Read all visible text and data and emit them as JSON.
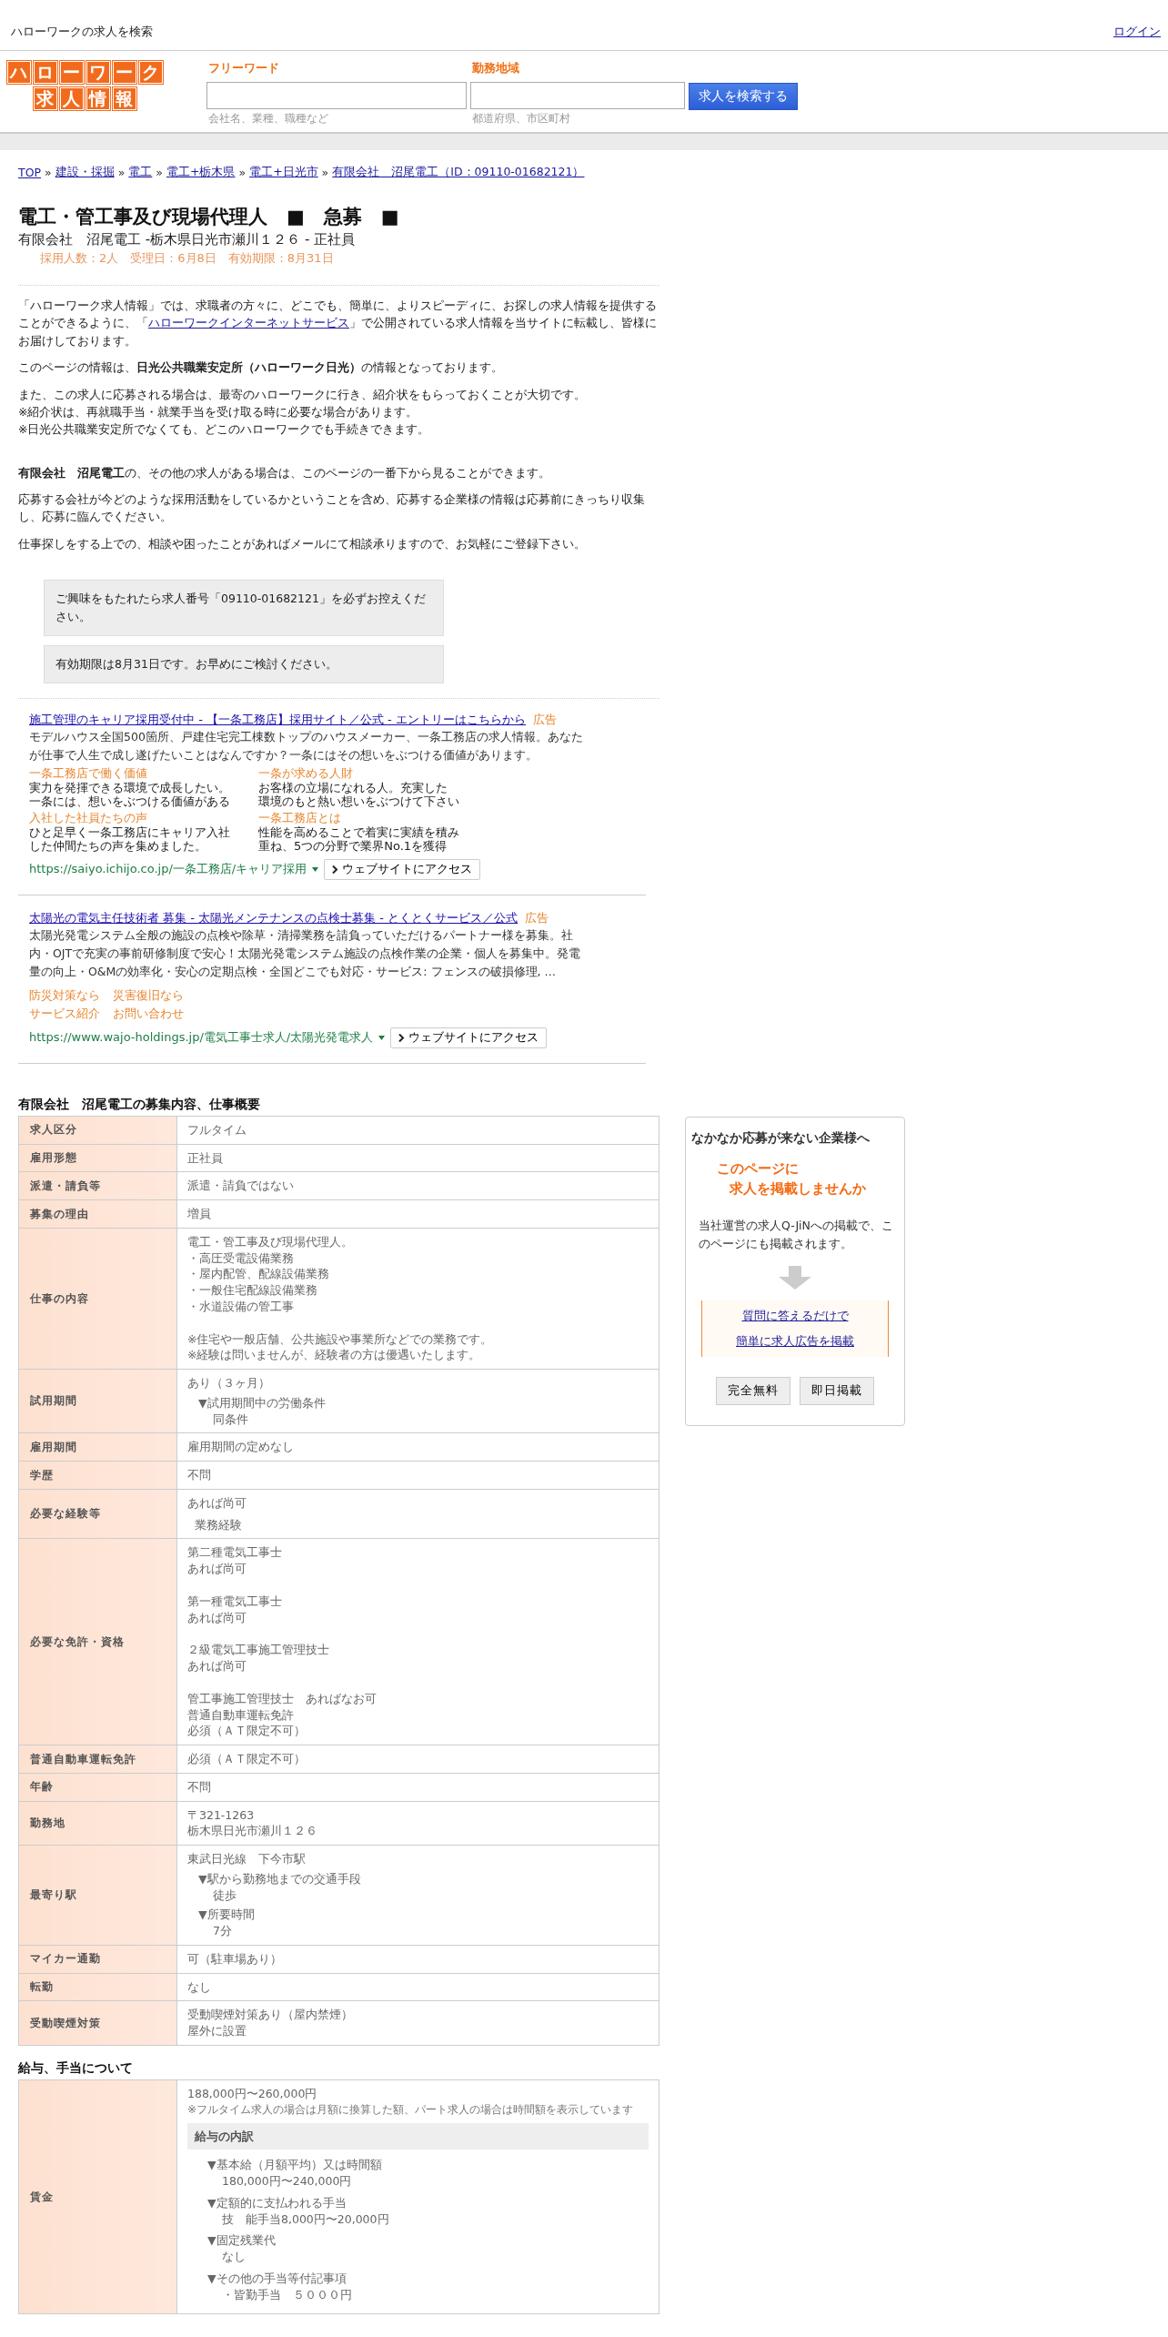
{
  "top_bar": {
    "title": "ハローワークの求人を検索",
    "login": "ログイン"
  },
  "logo": {
    "row_1": [
      "ハ",
      "ロ",
      "ー",
      "ワ",
      "ー",
      "ク"
    ],
    "row_2": [
      "求",
      "人",
      "情",
      "報"
    ]
  },
  "search": {
    "fields": [
      {
        "label": "フリーワード",
        "hint": "会社名、業種、職種など"
      },
      {
        "label": "勤務地域",
        "hint": "都道府県、市区町村"
      }
    ],
    "button": "求人を検索する"
  },
  "breadcrumb": [
    {
      "text": "TOP"
    },
    {
      "separator": "»",
      "text": "建設・採掘"
    },
    {
      "separator": "»",
      "text": "電工"
    },
    {
      "separator": "»",
      "text": "電工+栃木県"
    },
    {
      "separator": "»",
      "text": "電工+日光市"
    },
    {
      "separator": "»",
      "text": "有限会社　沼尾電工（ID：09110-01682121）"
    }
  ],
  "job": {
    "title": "電工・管工事及び現場代理人　■　急募　■",
    "subtitle": "有限会社　沼尾電工 -栃木県日光市瀬川１２６ - 正社員",
    "meta": "採用人数：2人　受理日：6月8日　有効期限：8月31日"
  },
  "intro": [
    [
      {
        "kind": "text",
        "text": "「ハローワーク求人情報」では、求職者の方々に、どこでも、簡単に、よりスピーディに、お探しの求人情報を提供することができるように、「"
      },
      {
        "kind": "link",
        "text": "ハローワークインターネットサービス"
      },
      {
        "kind": "text",
        "text": "」で公開されている求人情報を当サイトに転載し、皆様にお届けしております。"
      }
    ],
    [
      {
        "kind": "text",
        "text": "このページの情報は、**日光公共職業安定所（ハローワーク日光）**の情報となっております。"
      }
    ],
    [
      {
        "kind": "text",
        "text": "また、この求人に応募される場合は、最寄のハローワークに行き、紹介状をもらっておくことが大切です。"
      },
      {
        "kind": "break"
      },
      {
        "kind": "text",
        "text": "※紹介状は、再就職手当・就業手当を受け取る時に必要な場合があります。"
      },
      {
        "kind": "break"
      },
      {
        "kind": "text",
        "text": "※日光公共職業安定所でなくても、どこのハローワークでも手続きできます。"
      }
    ]
  ],
  "company_notes": [
    "**有限会社　沼尾電工**の、その他の求人がある場合は、このページの一番下から見ることができます。",
    "応募する会社が今どのような採用活動をしているかということを含め、応募する企業様の情報は応募前にきっちり収集し、応募に臨んでください。",
    "仕事探しをする上での、相談や困ったことがあればメールにて相談承りますので、お気軽にご登録下さい。"
  ],
  "notices": [
    "ご興味をもたれたら求人番号「09110-01682121」を必ずお控えください。",
    "有効期限は8月31日です。お早めにご検討ください。"
  ],
  "ads": [
    {
      "title": "施工管理のキャリア採用受付中 - 【一条工務店】採用サイト／公式 - エントリーはこちらから",
      "badge": "広告",
      "description": "モデルハウス全国500箇所、戸建住宅完工棟数トップのハウスメーカー、一条工務店の求人情報。あなたが仕事で人生で成し遂げたいことはなんですか？一条にはその想いをぶつける価値があります。",
      "kind": "sitelinks",
      "sitelinks": [
        {
          "title": "一条工務店で働く価値",
          "lines": [
            "実力を発揮できる環境で成長したい。",
            "一条には、想いをぶつける価値がある"
          ]
        },
        {
          "title": "一条が求める人財",
          "lines": [
            "お客様の立場になれる人。充実した",
            "環境のもと熱い想いをぶつけて下さい"
          ]
        },
        {
          "title": "入社した社員たちの声",
          "lines": [
            "ひと足早く一条工務店にキャリア入社",
            "した仲間たちの声を集めました。"
          ]
        },
        {
          "title": "一条工務店とは",
          "lines": [
            "性能を高めることで着実に実績を積み",
            "重ね、5つの分野で業界No.1を獲得"
          ]
        }
      ],
      "url": "https://saiyo.ichijo.co.jp/一条工務店/キャリア採用",
      "button": "ウェブサイトにアクセス"
    },
    {
      "title": "太陽光の電気主任技術者 募集 - 太陽光メンテナンスの点検士募集 - とくとくサービス／公式",
      "badge": "広告",
      "description": "太陽光発電システム全般の施設の点検や除草・清掃業務を請負っていただけるパートナー様を募集。社内・OJTで充実の事前研修制度で安心！太陽光発電システム施設の点検作業の企業・個人を募集中。発電量の向上・O&Mの効率化・安心の定期点検・全国どこでも対応・サービス: フェンスの破損修理, …",
      "kind": "quicklinks",
      "quicklinks": [
        [
          "防災対策なら",
          "災害復旧なら"
        ],
        [
          "サービス紹介",
          "お問い合わせ"
        ]
      ],
      "url": "https://www.wajo-holdings.jp/電気工事士求人/太陽光発電求人",
      "button": "ウェブサイトにアクセス"
    }
  ],
  "overview": {
    "title": "有限会社　沼尾電工の募集内容、仕事概要",
    "rows": [
      {
        "label": "求人区分",
        "kind": "plain",
        "blocks": [
          {
            "kind": "text",
            "lines": [
              "フルタイム"
            ]
          }
        ]
      },
      {
        "label": "雇用形態",
        "kind": "plain",
        "blocks": [
          {
            "kind": "text",
            "lines": [
              "正社員"
            ]
          }
        ]
      },
      {
        "label": "派遣・請負等",
        "kind": "plain",
        "blocks": [
          {
            "kind": "text",
            "lines": [
              "派遣・請負ではない"
            ]
          }
        ]
      },
      {
        "label": "募集の理由",
        "kind": "plain",
        "blocks": [
          {
            "kind": "text",
            "lines": [
              "増員"
            ]
          }
        ]
      },
      {
        "label": "仕事の内容",
        "kind": "plain",
        "blocks": [
          {
            "kind": "text",
            "lines": [
              "電工・管工事及び現場代理人。",
              "・高圧受電設備業務",
              "・屋内配管、配線設備業務",
              "・一般住宅配線設備業務",
              "・水道設備の管工事"
            ]
          },
          {
            "kind": "text",
            "lines": [
              "※住宅や一般店舗、公共施設や事業所などでの業務です。",
              "※経験は問いませんが、経験者の方は優遇いたします。"
            ]
          }
        ]
      },
      {
        "label": "試用期間",
        "kind": "plain",
        "blocks": [
          {
            "kind": "text",
            "lines": [
              "あり（３ヶ月）"
            ]
          },
          {
            "kind": "sub",
            "heading": "▼試用期間中の労働条件",
            "lines": [
              "同条件"
            ]
          }
        ]
      },
      {
        "label": "雇用期間",
        "kind": "plain",
        "blocks": [
          {
            "kind": "text",
            "lines": [
              "雇用期間の定めなし"
            ]
          }
        ]
      },
      {
        "label": "学歴",
        "kind": "plain",
        "blocks": [
          {
            "kind": "text",
            "lines": [
              "不問"
            ]
          }
        ]
      },
      {
        "label": "必要な経験等",
        "kind": "plain",
        "blocks": [
          {
            "kind": "text",
            "lines": [
              "あれば尚可"
            ]
          },
          {
            "kind": "indent",
            "lines": [
              "業務経験"
            ]
          }
        ]
      },
      {
        "label": "必要な免許・資格",
        "kind": "plain",
        "blocks": [
          {
            "kind": "text",
            "lines": [
              "第二種電気工事士",
              "あれば尚可"
            ]
          },
          {
            "kind": "text",
            "lines": [
              "第一種電気工事士",
              "あれば尚可"
            ]
          },
          {
            "kind": "text",
            "lines": [
              "２級電気工事施工管理技士",
              "あれば尚可"
            ]
          },
          {
            "kind": "text",
            "lines": [
              "管工事施工管理技士　あればなお可",
              "普通自動車運転免許",
              "必須（ＡＴ限定不可）"
            ]
          }
        ]
      },
      {
        "label": "普通自動車運転免許",
        "kind": "plain",
        "blocks": [
          {
            "kind": "text",
            "lines": [
              "必須（ＡＴ限定不可）"
            ]
          }
        ]
      },
      {
        "label": "年齢",
        "kind": "plain",
        "blocks": [
          {
            "kind": "text",
            "lines": [
              "不問"
            ]
          }
        ]
      },
      {
        "label": "勤務地",
        "kind": "plain",
        "blocks": [
          {
            "kind": "text",
            "lines": [
              "〒321-1263",
              "栃木県日光市瀬川１２６"
            ]
          }
        ]
      },
      {
        "label": "最寄り駅",
        "kind": "plain",
        "blocks": [
          {
            "kind": "text",
            "lines": [
              "東武日光線　下今市駅"
            ]
          },
          {
            "kind": "sub",
            "heading": "▼駅から勤務地までの交通手段",
            "lines": [
              "徒歩"
            ]
          },
          {
            "kind": "sub",
            "heading": "▼所要時間",
            "lines": [
              "7分"
            ]
          }
        ]
      },
      {
        "label": "マイカー通勤",
        "kind": "plain",
        "blocks": [
          {
            "kind": "text",
            "lines": [
              "可（駐車場あり）"
            ]
          }
        ]
      },
      {
        "label": "転勤",
        "kind": "plain",
        "blocks": [
          {
            "kind": "text",
            "lines": [
              "なし"
            ]
          }
        ]
      },
      {
        "label": "受動喫煙対策",
        "kind": "plain",
        "blocks": [
          {
            "kind": "text",
            "lines": [
              "受動喫煙対策あり（屋内禁煙）",
              "屋外に設置"
            ]
          }
        ]
      }
    ]
  },
  "salary": {
    "title": "給与、手当について",
    "rows": [
      {
        "label": "賃金",
        "kind": "wage",
        "range": "188,000円〜260,000円",
        "note": "※フルタイム求人の場合は月額に換算した額、パート求人の場合は時間額を表示しています",
        "breakdown_title": "給与の内訳",
        "items": [
          {
            "heading": "▼基本給（月額平均）又は時間額",
            "lines": [
              "180,000円〜240,000円"
            ]
          },
          {
            "heading": "▼定額的に支払われる手当",
            "lines": [
              "技　能手当8,000円〜20,000円"
            ]
          },
          {
            "heading": "▼固定残業代",
            "lines": [
              "なし"
            ]
          },
          {
            "heading": "▼その他の手当等付記事項",
            "lines": [
              "・皆勤手当　５０００円"
            ]
          }
        ]
      }
    ]
  },
  "sidebar": {
    "title": "なかなか応募が来ない企業様へ",
    "catch": [
      "このページに",
      "求人を掲載しませんか"
    ],
    "text": "当社運営の求人Q-JiNへの掲載で、このページにも掲載されます。",
    "links": [
      "質問に答えるだけで",
      "簡単に求人広告を掲載"
    ],
    "buttons": [
      "完全無料",
      "即日掲載"
    ]
  }
}
